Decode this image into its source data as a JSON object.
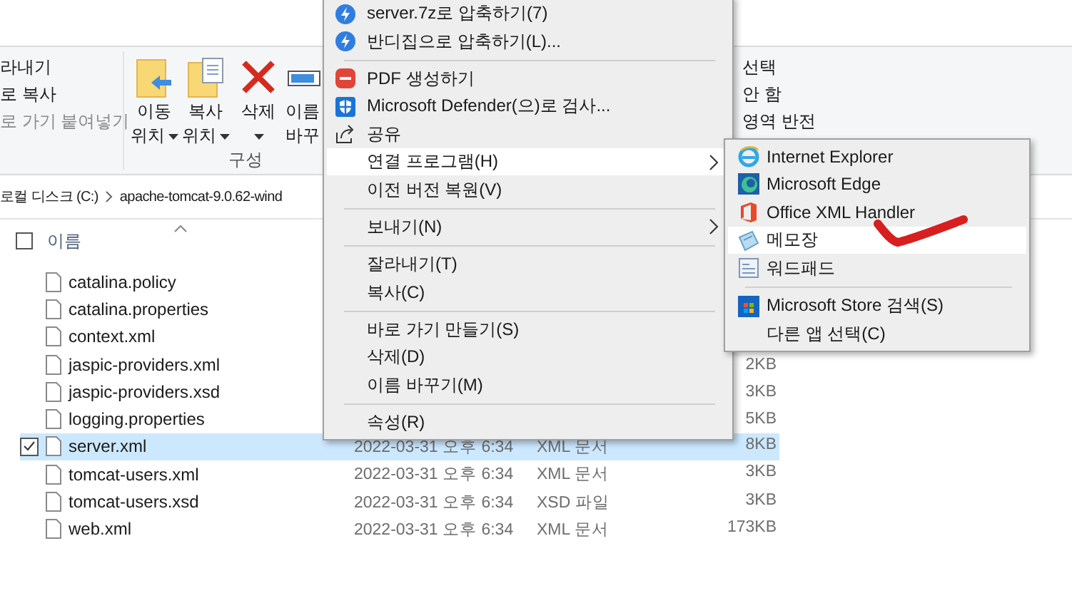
{
  "ribbon": {
    "clipboard_items": [
      {
        "label": "라내기",
        "disabled": false
      },
      {
        "label": "로 복사",
        "disabled": false
      },
      {
        "label": "로 가기 붙여넣기",
        "disabled": true
      }
    ],
    "organize": {
      "buttons": [
        {
          "lines": [
            "이동",
            "위치"
          ],
          "dropdown": true
        },
        {
          "lines": [
            "복사",
            "위치"
          ],
          "dropdown": true
        },
        {
          "lines": [
            "삭제"
          ],
          "dropdown": true
        },
        {
          "lines": [
            "이름",
            "바꾸"
          ],
          "dropdown": false
        }
      ],
      "group_label": "구성"
    },
    "select_items": [
      "선택",
      "안 함",
      "영역 반전"
    ]
  },
  "address_bar": {
    "segments": [
      "로컬 디스크 (C:)",
      "apache-tomcat-9.0.62-wind"
    ]
  },
  "file_list": {
    "columns": [
      "이름"
    ],
    "select_all_checked": false,
    "rows": [
      {
        "name": "catalina.policy",
        "selected": false
      },
      {
        "name": "catalina.properties",
        "selected": false
      },
      {
        "name": "context.xml",
        "selected": false
      },
      {
        "name": "jaspic-providers.xml",
        "size": "2KB",
        "selected": false
      },
      {
        "name": "jaspic-providers.xsd",
        "size": "3KB",
        "selected": false
      },
      {
        "name": "logging.properties",
        "size": "5KB",
        "selected": false
      },
      {
        "name": "server.xml",
        "date": "2022-03-31 오후 6:34",
        "type": "XML 문서",
        "size": "8KB",
        "selected": true
      },
      {
        "name": "tomcat-users.xml",
        "date": "2022-03-31 오후 6:34",
        "type": "XML 문서",
        "size": "3KB",
        "selected": false
      },
      {
        "name": "tomcat-users.xsd",
        "date": "2022-03-31 오후 6:34",
        "type": "XSD 파일",
        "size": "3KB",
        "selected": false
      },
      {
        "name": "web.xml",
        "date": "2022-03-31 오후 6:34",
        "type": "XML 문서",
        "size": "173KB",
        "selected": false
      }
    ]
  },
  "context_menu": {
    "items": [
      {
        "kind": "item",
        "label": "server.7z로 압축하기(7)",
        "submenu": false,
        "selected": false
      },
      {
        "kind": "item",
        "label": "반디집으로 압축하기(L)...",
        "submenu": false,
        "selected": false
      },
      {
        "kind": "separator"
      },
      {
        "kind": "item",
        "label": "PDF 생성하기",
        "submenu": false,
        "selected": false
      },
      {
        "kind": "item",
        "label": "Microsoft Defender(으)로 검사...",
        "submenu": false,
        "selected": false
      },
      {
        "kind": "item",
        "label": "공유",
        "submenu": false,
        "selected": false
      },
      {
        "kind": "item",
        "label": "연결 프로그램(H)",
        "submenu": true,
        "selected": true
      },
      {
        "kind": "item",
        "label": "이전 버전 복원(V)",
        "submenu": false,
        "selected": false
      },
      {
        "kind": "separator"
      },
      {
        "kind": "item",
        "label": "보내기(N)",
        "submenu": true,
        "selected": false
      },
      {
        "kind": "separator"
      },
      {
        "kind": "item",
        "label": "잘라내기(T)",
        "submenu": false,
        "selected": false
      },
      {
        "kind": "item",
        "label": "복사(C)",
        "submenu": false,
        "selected": false
      },
      {
        "kind": "separator"
      },
      {
        "kind": "item",
        "label": "바로 가기 만들기(S)",
        "submenu": false,
        "selected": false
      },
      {
        "kind": "item",
        "label": "삭제(D)",
        "submenu": false,
        "selected": false
      },
      {
        "kind": "item",
        "label": "이름 바꾸기(M)",
        "submenu": false,
        "selected": false
      },
      {
        "kind": "separator"
      },
      {
        "kind": "item",
        "label": "속성(R)",
        "submenu": false,
        "selected": false
      }
    ]
  },
  "open_with_menu": {
    "items": [
      {
        "kind": "item",
        "label": "Internet Explorer",
        "selected": false
      },
      {
        "kind": "item",
        "label": "Microsoft Edge",
        "selected": false
      },
      {
        "kind": "item",
        "label": "Office XML Handler",
        "selected": false
      },
      {
        "kind": "item",
        "label": "메모장",
        "selected": true
      },
      {
        "kind": "item",
        "label": "워드패드",
        "selected": false
      },
      {
        "kind": "separator"
      },
      {
        "kind": "item",
        "label": "Microsoft Store 검색(S)",
        "selected": false
      },
      {
        "kind": "item",
        "label": "다른 앱 선택(C)",
        "selected": false
      }
    ]
  }
}
